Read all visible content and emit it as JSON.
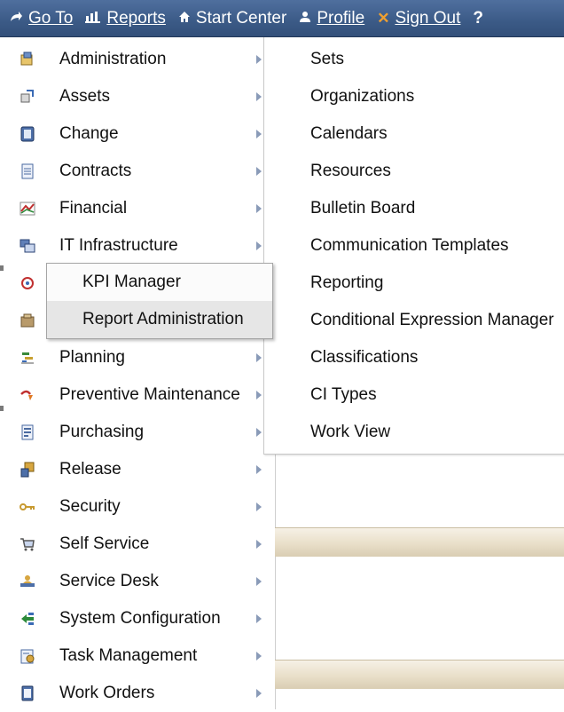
{
  "toolbar": {
    "items": [
      {
        "label": "Go To",
        "icon": "go-to-arrow-icon"
      },
      {
        "label": "Reports",
        "icon": "reports-chart-icon"
      },
      {
        "label": "Start Center",
        "icon": "home-icon"
      },
      {
        "label": "Profile",
        "icon": "profile-person-icon"
      },
      {
        "label": "Sign Out",
        "icon": "sign-out-x-icon"
      },
      {
        "label": "?",
        "icon": "help-icon"
      }
    ]
  },
  "menu": {
    "items": [
      {
        "label": "Administration",
        "icon": "administration-icon"
      },
      {
        "label": "Assets",
        "icon": "assets-icon"
      },
      {
        "label": "Change",
        "icon": "change-icon"
      },
      {
        "label": "Contracts",
        "icon": "contracts-icon"
      },
      {
        "label": "Financial",
        "icon": "financial-icon"
      },
      {
        "label": "IT Infrastructure",
        "icon": "it-infrastructure-icon"
      },
      {
        "label": "",
        "icon": "integration-icon"
      },
      {
        "label": "",
        "icon": "inventory-icon"
      },
      {
        "label": "Planning",
        "icon": "planning-icon"
      },
      {
        "label": "Preventive Maintenance",
        "icon": "preventive-maintenance-icon"
      },
      {
        "label": "Purchasing",
        "icon": "purchasing-icon"
      },
      {
        "label": "Release",
        "icon": "release-icon"
      },
      {
        "label": "Security",
        "icon": "security-key-icon"
      },
      {
        "label": "Self Service",
        "icon": "self-service-cart-icon"
      },
      {
        "label": "Service Desk",
        "icon": "service-desk-icon"
      },
      {
        "label": "System Configuration",
        "icon": "system-configuration-icon"
      },
      {
        "label": "Task Management",
        "icon": "task-management-icon"
      },
      {
        "label": "Work Orders",
        "icon": "work-orders-icon"
      }
    ]
  },
  "flyout": {
    "items": [
      {
        "label": "KPI Manager"
      },
      {
        "label": "Report Administration"
      }
    ]
  },
  "submenu": {
    "items": [
      {
        "label": "Sets"
      },
      {
        "label": "Organizations"
      },
      {
        "label": "Calendars"
      },
      {
        "label": "Resources"
      },
      {
        "label": "Bulletin Board"
      },
      {
        "label": "Communication Templates"
      },
      {
        "label": "Reporting"
      },
      {
        "label": "Conditional Expression Manager"
      },
      {
        "label": "Classifications"
      },
      {
        "label": "CI Types"
      },
      {
        "label": "Work View"
      }
    ]
  },
  "colors": {
    "toolbar_bg": "#3b5a86",
    "toolbar_text": "#ffffff",
    "sign_out_x": "#f0a030",
    "menu_arrow": "#8a9bb8",
    "highlight": "#e6e6e6"
  }
}
